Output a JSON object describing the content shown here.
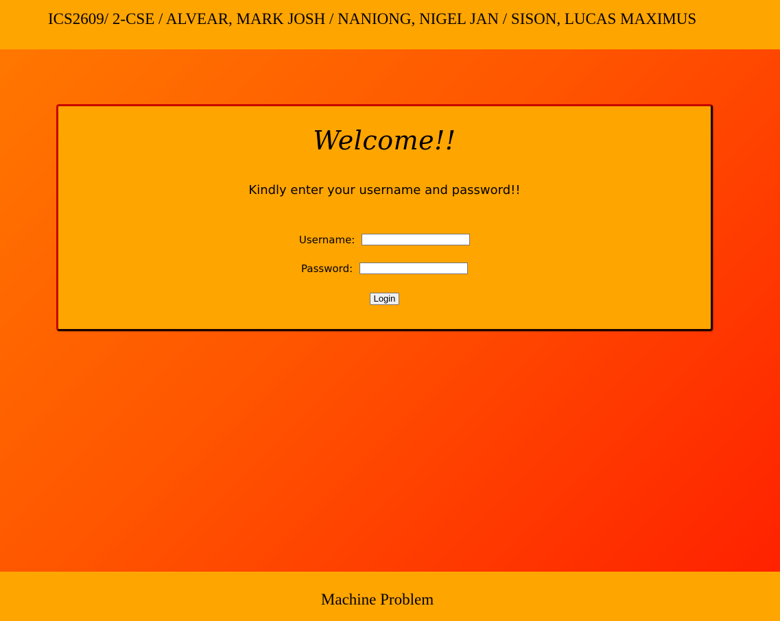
{
  "header": {
    "title": "ICS2609/ 2-CSE / ALVEAR, MARK JOSH / NANIONG, NIGEL JAN / SISON, LUCAS MAXIMUS"
  },
  "login_card": {
    "title": "Welcome!!",
    "instruction": "Kindly enter your username and password!!",
    "username": {
      "label": "Username:",
      "value": ""
    },
    "password": {
      "label": "Password:",
      "value": ""
    },
    "login_button_label": "Login"
  },
  "footer": {
    "text": "Machine Problem"
  },
  "colors": {
    "panel_background": "#ffa500",
    "gradient_start": "#ff7a00",
    "gradient_end": "#ff1e00",
    "card_border_dark": "#1a0000",
    "card_border_red": "#c60000"
  }
}
